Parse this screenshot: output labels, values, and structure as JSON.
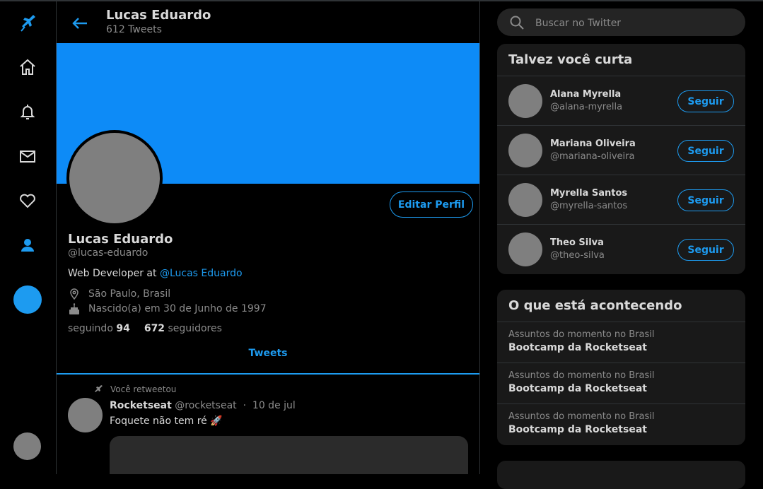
{
  "nav": {
    "items": [
      {
        "icon": "bird-logo-icon"
      },
      {
        "icon": "home-icon"
      },
      {
        "icon": "bell-icon"
      },
      {
        "icon": "mail-icon"
      },
      {
        "icon": "heart-icon"
      },
      {
        "icon": "user-icon"
      }
    ],
    "active_color": "#1d9bf0"
  },
  "header": {
    "name": "Lucas Eduardo",
    "tweet_count": "612 Tweets"
  },
  "profile": {
    "banner_color": "#0d8bf7",
    "edit_label": "Editar Perfil",
    "name": "Lucas Eduardo",
    "handle": "@lucas-eduardo",
    "bio_text": "Web Developer at ",
    "bio_link": "@Lucas Eduardo",
    "location": "São Paulo, Brasil",
    "birth": "Nascido(a) em 30 de Junho de 1997",
    "following_label": "seguindo",
    "following_count": "94",
    "followers_count": "672",
    "followers_label": "seguidores"
  },
  "tabs": {
    "active": "Tweets"
  },
  "tweet": {
    "retweet_note": "Você retweetou",
    "name": "Rocketseat",
    "handle": "@rocketseat",
    "separator": "·",
    "date": "10 de jul",
    "text": "Foquete não tem ré 🚀"
  },
  "search": {
    "placeholder": "Buscar no Twitter"
  },
  "who_to_follow": {
    "title": "Talvez você curta",
    "follow_label": "Seguir",
    "users": [
      {
        "name": "Alana Myrella",
        "handle": "@alana-myrella"
      },
      {
        "name": "Mariana Oliveira",
        "handle": "@mariana-oliveira"
      },
      {
        "name": "Myrella Santos",
        "handle": "@myrella-santos"
      },
      {
        "name": "Theo Silva",
        "handle": "@theo-silva"
      }
    ]
  },
  "trends": {
    "title": "O que está acontecendo",
    "items": [
      {
        "label": "Assuntos do momento no Brasil",
        "topic": "Bootcamp da Rocketseat"
      },
      {
        "label": "Assuntos do momento no Brasil",
        "topic": "Bootcamp da Rocketseat"
      },
      {
        "label": "Assuntos do momento no Brasil",
        "topic": "Bootcamp da Rocketseat"
      }
    ]
  }
}
